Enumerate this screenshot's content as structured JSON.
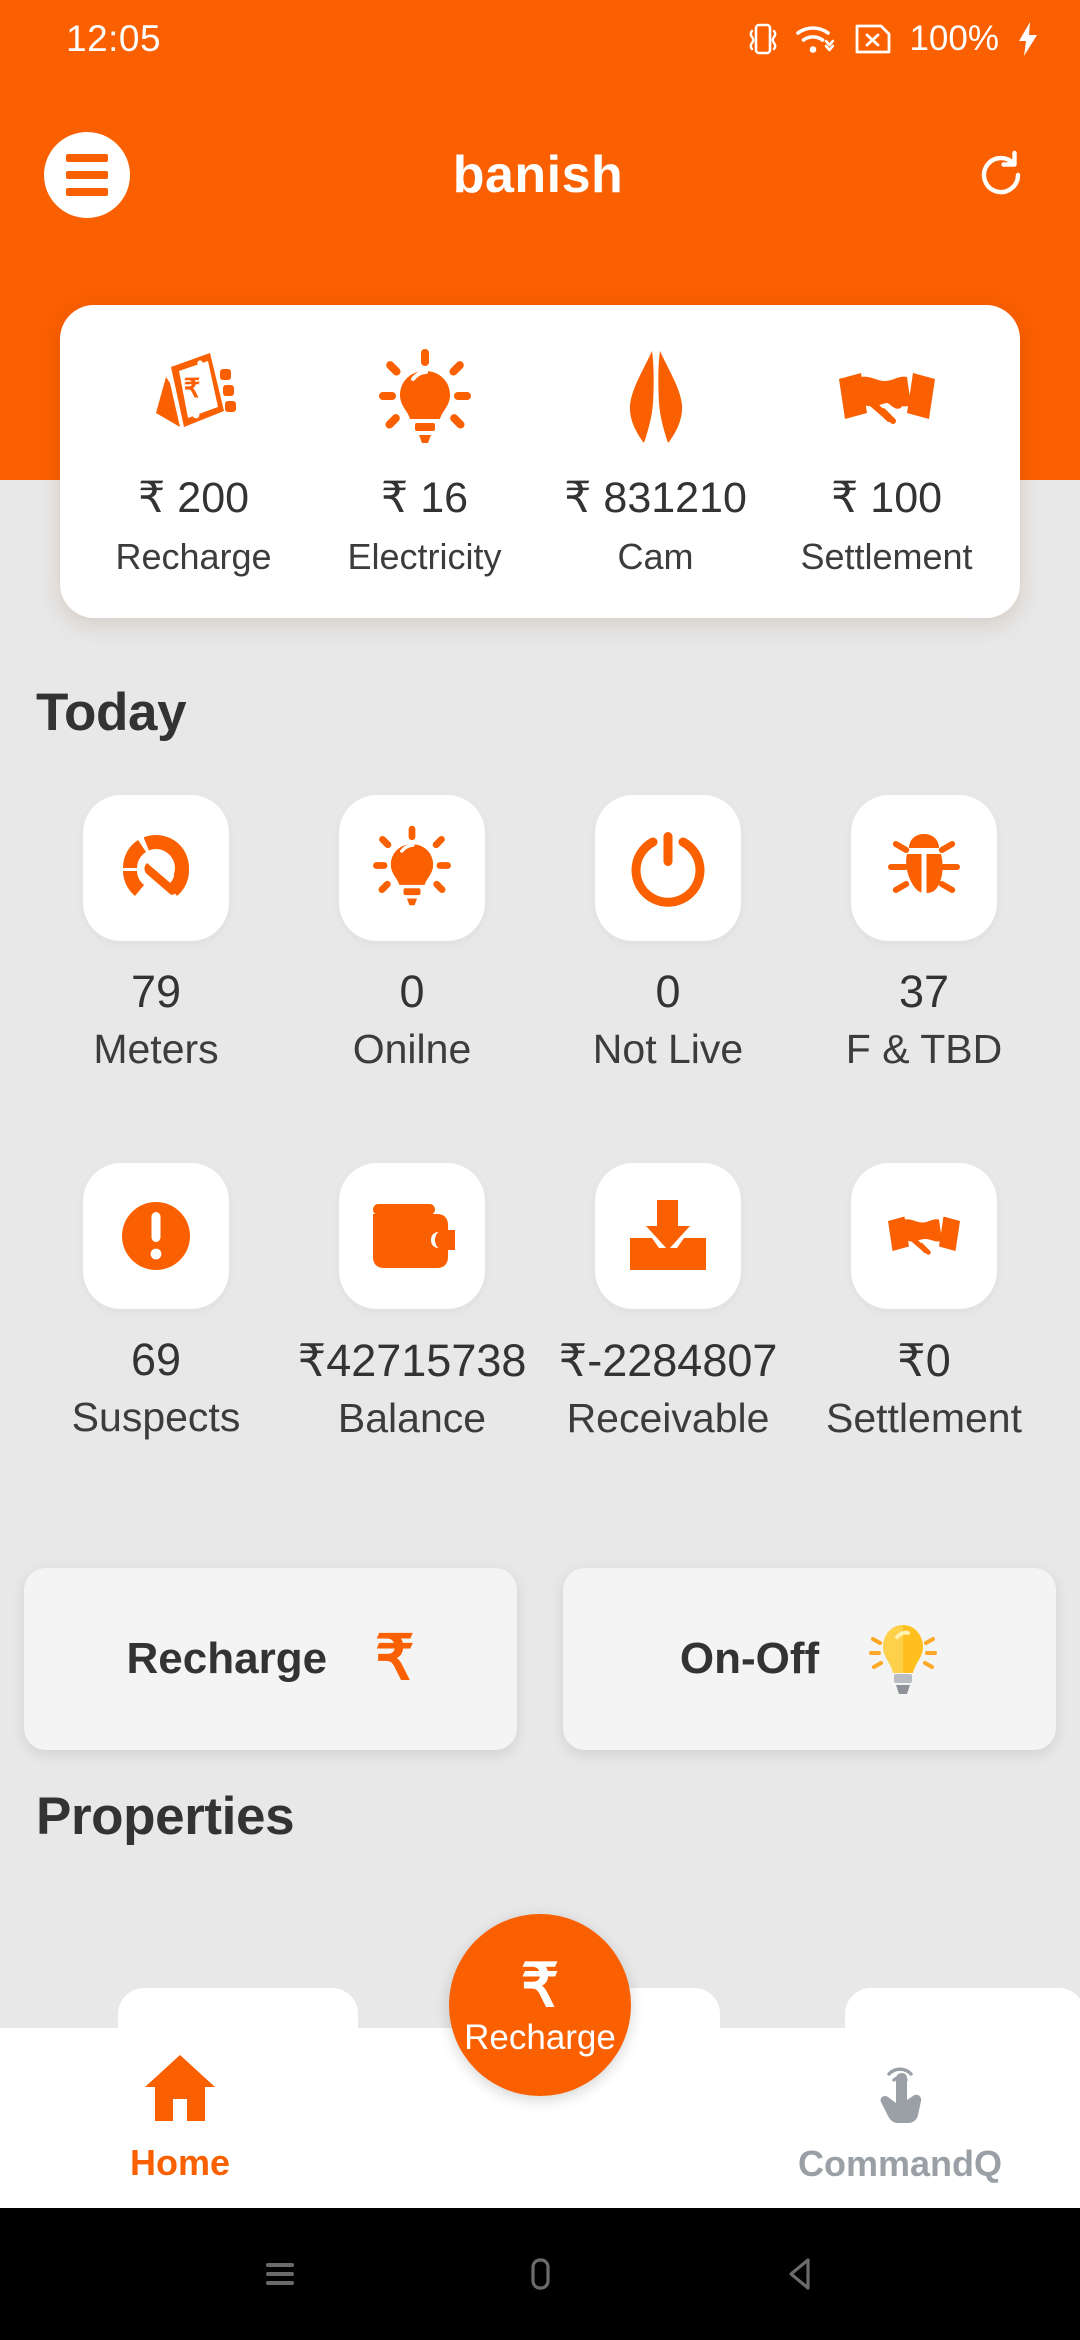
{
  "theme": {
    "brand_orange": "#fa5f00",
    "page_background": "#e8e8e8",
    "card_white": "#ffffff",
    "text_dark": "#333333",
    "text_muted": "#9aa0a6"
  },
  "statusbar": {
    "time": "12:05",
    "battery_percent": "100%",
    "icons": [
      "vibrate-icon",
      "wifi-icon",
      "no-sim-icon",
      "charging-bolt-icon"
    ]
  },
  "appbar": {
    "title": "banish",
    "menu_icon": "hamburger-menu-icon",
    "refresh_icon": "refresh-icon"
  },
  "summary_card": {
    "items": [
      {
        "icon": "mobile-recharge-icon",
        "amount": "₹ 200",
        "label": "Recharge"
      },
      {
        "icon": "lightbulb-icon",
        "amount": "₹ 16",
        "label": "Electricity"
      },
      {
        "icon": "namaste-hands-icon",
        "amount": "₹ 831210",
        "label": "Cam"
      },
      {
        "icon": "handshake-icon",
        "amount": "₹ 100",
        "label": "Settlement"
      }
    ]
  },
  "today": {
    "title": "Today",
    "stats": [
      {
        "icon": "speedometer-icon",
        "value": "79",
        "label": "Meters"
      },
      {
        "icon": "lightbulb-icon",
        "value": "0",
        "label": "Onilne"
      },
      {
        "icon": "power-icon",
        "value": "0",
        "label": "Not Live"
      },
      {
        "icon": "bug-icon",
        "value": "37",
        "label": "F & TBD"
      },
      {
        "icon": "exclamation-circle-icon",
        "value": "69",
        "label": "Suspects"
      },
      {
        "icon": "wallet-icon",
        "value": "₹42715738",
        "label": "Balance"
      },
      {
        "icon": "download-inbox-icon",
        "value": "₹-2284807",
        "label": "Receivable"
      },
      {
        "icon": "handshake-icon",
        "value": "₹0",
        "label": "Settlement"
      }
    ]
  },
  "actions": [
    {
      "label": "Recharge",
      "glyph": "₹",
      "icon": "rupee-icon"
    },
    {
      "label": "On-Off",
      "glyph": "💡",
      "icon": "yellow-lightbulb-icon"
    }
  ],
  "properties": {
    "title": "Properties"
  },
  "bottom_nav": {
    "items": [
      {
        "label": "Home",
        "icon": "home-icon",
        "active": true
      },
      {
        "label": "CommandQ",
        "icon": "tap-gesture-icon",
        "active": false
      }
    ],
    "fab": {
      "label": "Recharge",
      "glyph": "₹",
      "icon": "rupee-icon"
    }
  },
  "android_nav": {
    "recents_icon": "recents-icon",
    "home_icon": "android-home-icon",
    "back_icon": "android-back-icon"
  }
}
